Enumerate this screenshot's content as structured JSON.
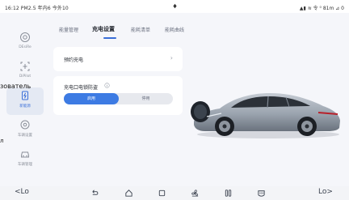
{
  "status_bar": {
    "time": "16:12 PM2.5 年内6 今外10",
    "right": "▲▮ ≋ 令 ⁰ 81m ⊿ 0"
  },
  "sidebar": {
    "items": [
      {
        "label": "DEsiRe",
        "icon": "target-icon"
      },
      {
        "label": "DiPilot",
        "icon": "steering-frame-icon"
      },
      {
        "label": "新能源",
        "icon": "battery-plug-icon",
        "active": true
      },
      {
        "label": "车辆设置",
        "icon": "car-settings-icon"
      },
      {
        "label": "车辆管理",
        "icon": "car-manage-icon"
      }
    ]
  },
  "left_overlay_text": "зователь",
  "left_overlay_text2": "л",
  "tabs": [
    {
      "label": "能量管理"
    },
    {
      "label": "充电设置",
      "active": true
    },
    {
      "label": "能耗清单"
    },
    {
      "label": "能耗曲线"
    }
  ],
  "scheduled_charge": {
    "label": "预约充电",
    "chevron": "›"
  },
  "charge_port_lock": {
    "label": "充电口电锁防盗",
    "info_icon": "info-icon",
    "options": [
      "启用",
      "停用"
    ],
    "selected": "启用"
  },
  "bottom_nav": {
    "left_temp": "<Lo",
    "right_temp": "Lo>",
    "icons": [
      "back-icon",
      "home-icon",
      "recents-icon",
      "fan-icon",
      "seat-heat-icon",
      "defrost-icon"
    ]
  },
  "colors": {
    "accent": "#3d7be3",
    "background": "#f5f6fa"
  }
}
